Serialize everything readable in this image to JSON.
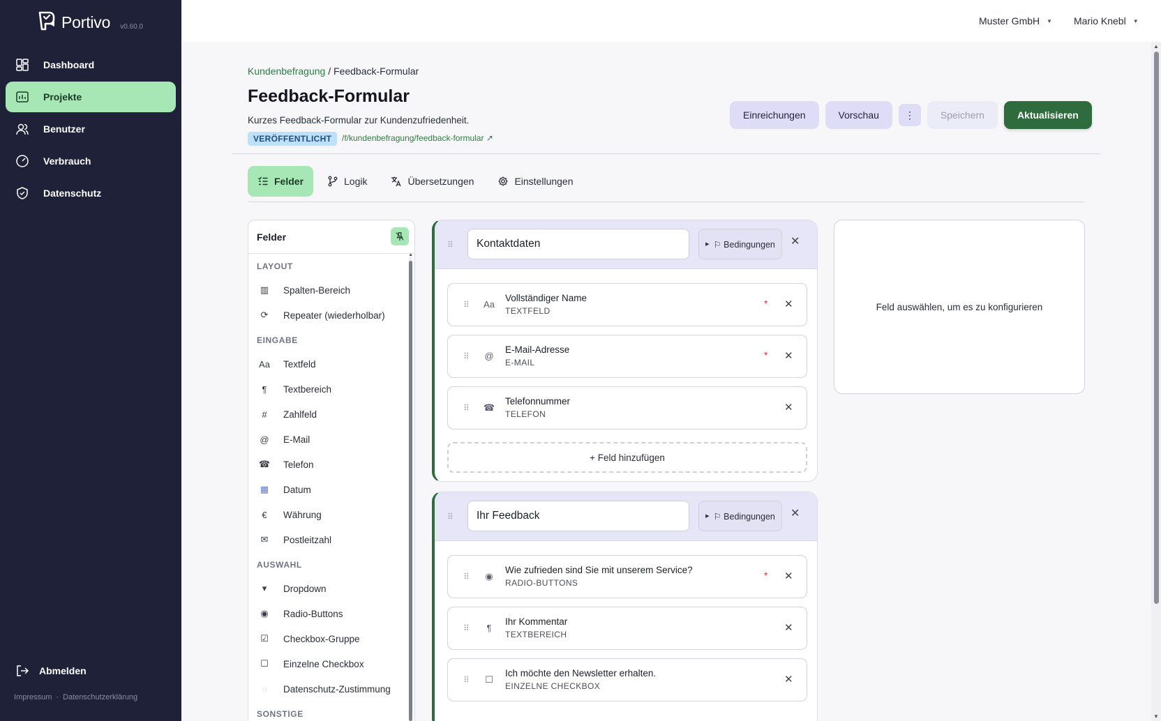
{
  "app": {
    "name": "Portivo",
    "version": "v0.60.0"
  },
  "sidebar": {
    "items": [
      {
        "label": "Dashboard",
        "icon": "dashboard-icon",
        "active": false
      },
      {
        "label": "Projekte",
        "icon": "projects-icon",
        "active": true
      },
      {
        "label": "Benutzer",
        "icon": "users-icon",
        "active": false
      },
      {
        "label": "Verbrauch",
        "icon": "gauge-icon",
        "active": false
      },
      {
        "label": "Datenschutz",
        "icon": "shield-icon",
        "active": false
      }
    ],
    "logout_label": "Abmelden",
    "footer": {
      "impressum": "Impressum",
      "separator": "·",
      "privacy": "Datenschutzerklärung"
    }
  },
  "header": {
    "org_menu": "Muster GmbH",
    "user_menu": "Mario Knebl"
  },
  "page": {
    "breadcrumb": {
      "parent": "Kundenbefragung",
      "separator": "/",
      "current": "Feedback-Formular"
    },
    "title": "Feedback-Formular",
    "description": "Kurzes Feedback-Formular zur Kundenzufriedenheit.",
    "status_badge": "VERÖFFENTLICHT",
    "slug": "/f/kundenbefragung/feedback-formular ↗",
    "actions": {
      "submissions": "Einreichungen",
      "preview": "Vorschau",
      "more": "⋮",
      "save": "Speichern",
      "update": "Aktualisieren"
    }
  },
  "tabs": [
    {
      "label": "Felder",
      "icon": "fields-icon",
      "active": true
    },
    {
      "label": "Logik",
      "icon": "branch-icon",
      "active": false
    },
    {
      "label": "Übersetzungen",
      "icon": "translate-icon",
      "active": false
    },
    {
      "label": "Einstellungen",
      "icon": "gear-icon",
      "active": false
    }
  ],
  "palette": {
    "title": "Felder",
    "groups": [
      {
        "label": "LAYOUT",
        "items": [
          {
            "label": "Spalten-Bereich",
            "glyph": "▥",
            "icon": "columns-icon"
          },
          {
            "label": "Repeater (wiederholbar)",
            "glyph": "⟳",
            "icon": "repeat-icon"
          }
        ]
      },
      {
        "label": "EINGABE",
        "items": [
          {
            "label": "Textfeld",
            "glyph": "Aa",
            "icon": "text-icon"
          },
          {
            "label": "Textbereich",
            "glyph": "¶",
            "icon": "paragraph-icon"
          },
          {
            "label": "Zahlfeld",
            "glyph": "#",
            "icon": "number-icon"
          },
          {
            "label": "E-Mail",
            "glyph": "@",
            "icon": "email-icon"
          },
          {
            "label": "Telefon",
            "glyph": "☎",
            "icon": "phone-icon"
          },
          {
            "label": "Datum",
            "glyph": "▦",
            "icon": "calendar-icon"
          },
          {
            "label": "Währung",
            "glyph": "€",
            "icon": "currency-icon"
          },
          {
            "label": "Postleitzahl",
            "glyph": "✉",
            "icon": "postal-icon"
          }
        ]
      },
      {
        "label": "AUSWAHL",
        "items": [
          {
            "label": "Dropdown",
            "glyph": "▾",
            "icon": "dropdown-icon"
          },
          {
            "label": "Radio-Buttons",
            "glyph": "◉",
            "icon": "radio-icon"
          },
          {
            "label": "Checkbox-Gruppe",
            "glyph": "☑",
            "icon": "checkbox-group-icon"
          },
          {
            "label": "Einzelne Checkbox",
            "glyph": "☐",
            "icon": "checkbox-icon"
          },
          {
            "label": "Datenschutz-Zustimmung",
            "glyph": "◌",
            "icon": "consent-icon"
          }
        ]
      },
      {
        "label": "SONSTIGE",
        "items": []
      }
    ]
  },
  "sections": [
    {
      "title": "Kontaktdaten",
      "conditions_label": "⚐ Bedingungen",
      "fields": [
        {
          "label": "Vollständiger Name",
          "type": "TEXTFELD",
          "glyph": "Aa",
          "icon": "text-icon",
          "required": true
        },
        {
          "label": "E-Mail-Adresse",
          "type": "E-MAIL",
          "glyph": "@",
          "icon": "email-icon",
          "required": true
        },
        {
          "label": "Telefonnummer",
          "type": "TELEFON",
          "glyph": "☎",
          "icon": "phone-icon",
          "required": false
        }
      ],
      "add_field_label": "+ Feld hinzufügen"
    },
    {
      "title": "Ihr Feedback",
      "conditions_label": "⚐ Bedingungen",
      "fields": [
        {
          "label": "Wie zufrieden sind Sie mit unserem Service?",
          "type": "RADIO-BUTTONS",
          "glyph": "◉",
          "icon": "radio-icon",
          "required": true
        },
        {
          "label": "Ihr Kommentar",
          "type": "TEXTBEREICH",
          "glyph": "¶",
          "icon": "paragraph-icon",
          "required": false
        },
        {
          "label": "Ich möchte den Newsletter erhalten.",
          "type": "EINZELNE CHECKBOX",
          "glyph": "☐",
          "icon": "checkbox-icon",
          "required": false
        }
      ]
    }
  ],
  "config_panel": {
    "empty_text": "Feld auswählen, um es zu konfigurieren"
  },
  "required_marker": "*"
}
